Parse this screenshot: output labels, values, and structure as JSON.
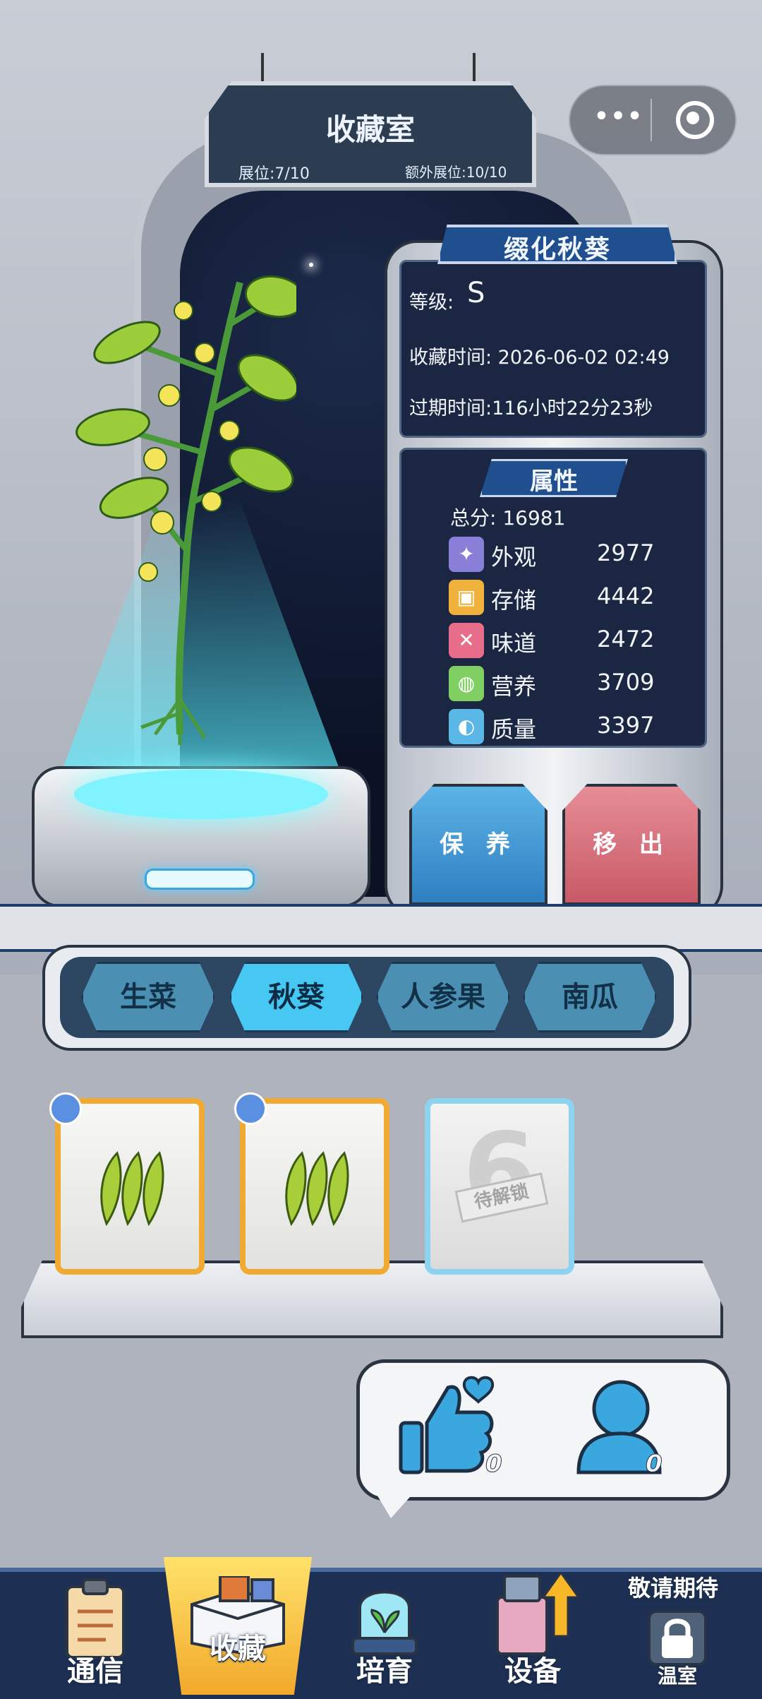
{
  "room": {
    "title": "收藏室",
    "slots": "展位:7/10",
    "extra_slots": "额外展位:10/10"
  },
  "capsule": {
    "more_label": "•••",
    "more_icon": "more-dots-icon",
    "close_icon": "target-close-icon"
  },
  "plant": {
    "name": "缀化秋葵",
    "grade_label": "等级:",
    "grade_value": "S",
    "collect_time": "收藏时间: 2026-06-02 02:49",
    "expire_time": "过期时间:116小时22分23秒"
  },
  "attributes": {
    "title": "属性",
    "total": "总分: 16981",
    "items": [
      {
        "name": "外观",
        "value": "2977",
        "icon": "sparkle-icon",
        "color": "#8a7fd8"
      },
      {
        "name": "存储",
        "value": "4442",
        "icon": "box-icon",
        "color": "#f0b23a"
      },
      {
        "name": "味道",
        "value": "2472",
        "icon": "utensils-icon",
        "color": "#e86d8a"
      },
      {
        "name": "营养",
        "value": "3709",
        "icon": "lemon-icon",
        "color": "#7fcf62"
      },
      {
        "name": "质量",
        "value": "3397",
        "icon": "muscle-icon",
        "color": "#5ab7e6"
      }
    ]
  },
  "actions": {
    "maintain": "保 养",
    "remove": "移 出"
  },
  "tabs": [
    "生菜",
    "秋葵",
    "人参果",
    "南瓜"
  ],
  "active_tab": "秋葵",
  "cards": [
    {
      "type": "okra",
      "timer": true
    },
    {
      "type": "okra",
      "timer": true
    },
    {
      "type": "locked",
      "number": "6",
      "label": "待解锁"
    }
  ],
  "social": {
    "likes": "0",
    "visitors": "0"
  },
  "nav": {
    "items": [
      "通信",
      "收藏",
      "培育",
      "设备",
      "温室"
    ],
    "coming_soon": "敬请期待"
  },
  "colors": {
    "accent_blue": "#47c8f3",
    "gold": "#f0a931",
    "panel_dark": "#1b2742",
    "remove_red": "#c85a67"
  }
}
